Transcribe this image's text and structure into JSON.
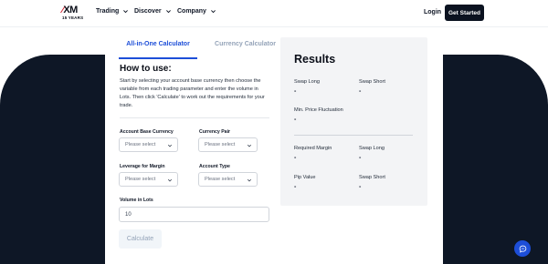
{
  "brand": {
    "logo_text": "XM",
    "logo_sub": "15 YEARS"
  },
  "nav": {
    "items": [
      {
        "label": "Trading"
      },
      {
        "label": "Discover"
      },
      {
        "label": "Company"
      }
    ],
    "login_label": "Login",
    "cta_label": "Get Started"
  },
  "calculator": {
    "tabs": [
      {
        "label": "All-in-One Calculator",
        "active": true
      },
      {
        "label": "Currency Calculator",
        "active": false
      }
    ],
    "how_to_title": "How to use:",
    "how_to_text": "Start by selecting your account base currency then choose the variable from each trading parameter and enter the volume in Lots. Then click 'Calculate' to work out the requirements for your trade.",
    "fields": {
      "account_base_currency": {
        "label": "Account Base Currency",
        "placeholder": "Please select"
      },
      "currency_pair": {
        "label": "Currency Pair",
        "placeholder": "Please select"
      },
      "leverage_for_margin": {
        "label": "Leverage for Margin",
        "placeholder": "Please select"
      },
      "account_type": {
        "label": "Account Type",
        "placeholder": "Please select"
      },
      "volume_in_lots": {
        "label": "Volume in Lots",
        "value": "10"
      }
    },
    "calculate_label": "Calculate"
  },
  "results": {
    "title": "Results",
    "swap_long_top": {
      "label": "Swap Long",
      "value": "-"
    },
    "swap_short_top": {
      "label": "Swap Short",
      "value": "-"
    },
    "min_price_fluctuation": {
      "label": "Min. Price Fluctuation",
      "value": "-"
    },
    "required_margin": {
      "label": "Required Margin",
      "value": "-"
    },
    "swap_long_bottom": {
      "label": "Swap Long",
      "value": "-"
    },
    "pip_value": {
      "label": "Pip Value",
      "value": "-"
    },
    "swap_short_bottom": {
      "label": "Swap Short",
      "value": "-"
    }
  },
  "colors": {
    "accent": "#1d4ed8",
    "dark_band": "#0e1726",
    "brand_red": "#d11d2a"
  },
  "icons": [
    "chevron-down-icon",
    "chat-icon"
  ]
}
